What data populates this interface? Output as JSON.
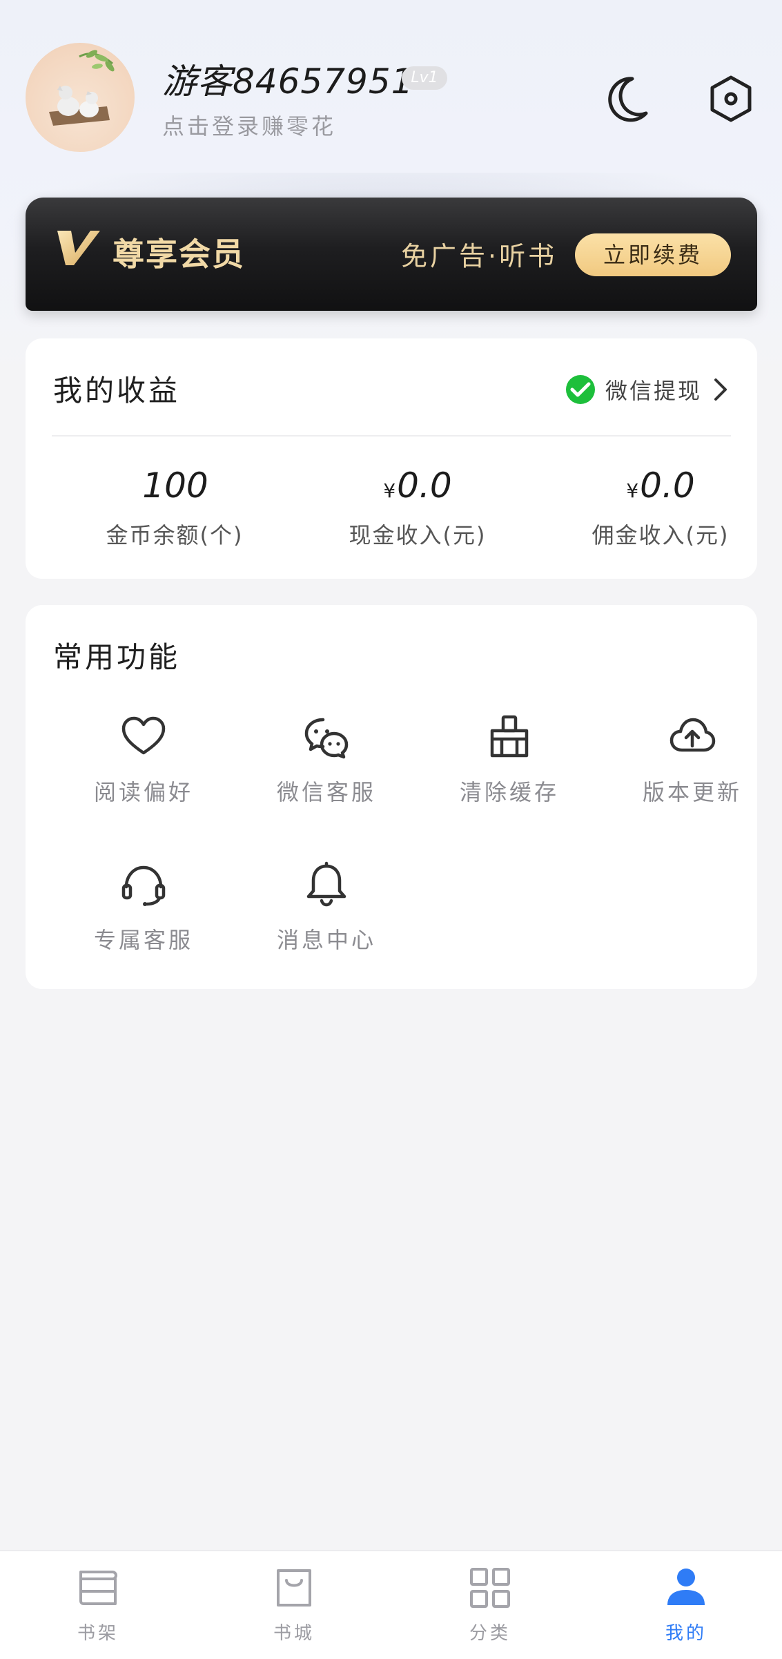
{
  "profile": {
    "username": "游客84657951",
    "level": "Lv1",
    "login_hint": "点击登录赚零花",
    "avatar_icon": "avatar-illustration",
    "night_mode_icon": "moon-icon",
    "settings_icon": "settings-hexagon-icon"
  },
  "vip": {
    "title": "尊享会员",
    "benefit": "免广告·听书",
    "renew_label": "立即续费",
    "colors": {
      "banner": "#1e1e20",
      "gold": "#f1d9a6",
      "button": "#f5d08c"
    }
  },
  "earnings": {
    "title": "我的收益",
    "withdraw_label": "微信提现",
    "withdraw_icon": "wechat-pay-icon",
    "stats": [
      {
        "currency": "",
        "value": "100",
        "caption": "金币余额(个)"
      },
      {
        "currency": "¥",
        "value": "0.0",
        "caption": "现金收入(元)"
      },
      {
        "currency": "¥",
        "value": "0.0",
        "caption": "佣金收入(元)"
      }
    ]
  },
  "features": {
    "title": "常用功能",
    "items": [
      {
        "label": "阅读偏好",
        "icon": "heart-icon"
      },
      {
        "label": "微信客服",
        "icon": "wechat-chat-icon"
      },
      {
        "label": "清除缓存",
        "icon": "broom-icon"
      },
      {
        "label": "版本更新",
        "icon": "cloud-upload-icon"
      },
      {
        "label": "专属客服",
        "icon": "headset-icon"
      },
      {
        "label": "消息中心",
        "icon": "bell-icon"
      }
    ]
  },
  "tabbar": {
    "active_color": "#2f7cf6",
    "items": [
      {
        "label": "书架",
        "icon": "bookshelf-icon",
        "active": false
      },
      {
        "label": "书城",
        "icon": "shopping-bag-icon",
        "active": false
      },
      {
        "label": "分类",
        "icon": "grid-icon",
        "active": false
      },
      {
        "label": "我的",
        "icon": "user-icon",
        "active": true
      }
    ]
  }
}
